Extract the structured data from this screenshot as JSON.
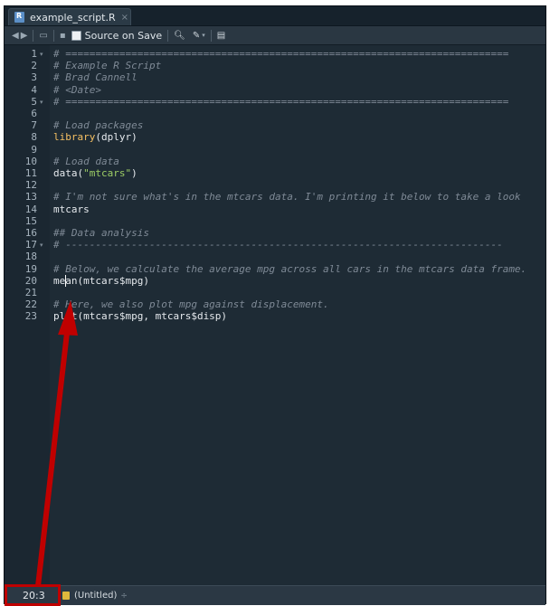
{
  "tab": {
    "label": "example_script.R",
    "close": "×"
  },
  "toolbar": {
    "source_on_save": "Source on Save"
  },
  "editor": {
    "lines": [
      {
        "n": "1",
        "fold": true,
        "segs": [
          {
            "t": "# ==========================================================================",
            "c": "cm"
          }
        ]
      },
      {
        "n": "2",
        "segs": [
          {
            "t": "# Example R Script",
            "c": "cm"
          }
        ]
      },
      {
        "n": "3",
        "segs": [
          {
            "t": "# Brad Cannell",
            "c": "cm"
          }
        ]
      },
      {
        "n": "4",
        "segs": [
          {
            "t": "# <Date>",
            "c": "cm"
          }
        ]
      },
      {
        "n": "5",
        "fold": true,
        "segs": [
          {
            "t": "# ==========================================================================",
            "c": "cm"
          }
        ]
      },
      {
        "n": "6",
        "segs": []
      },
      {
        "n": "7",
        "segs": [
          {
            "t": "# Load packages",
            "c": "cm"
          }
        ]
      },
      {
        "n": "8",
        "segs": [
          {
            "t": "library",
            "c": "fn"
          },
          {
            "t": "(dplyr)",
            "c": ""
          }
        ]
      },
      {
        "n": "9",
        "segs": []
      },
      {
        "n": "10",
        "segs": [
          {
            "t": "# Load data",
            "c": "cm"
          }
        ]
      },
      {
        "n": "11",
        "segs": [
          {
            "t": "data(",
            "c": ""
          },
          {
            "t": "\"mtcars\"",
            "c": "str"
          },
          {
            "t": ")",
            "c": ""
          }
        ]
      },
      {
        "n": "12",
        "segs": []
      },
      {
        "n": "13",
        "segs": [
          {
            "t": "# I'm not sure what's in the mtcars data. I'm printing it below to take a look",
            "c": "cm"
          }
        ]
      },
      {
        "n": "14",
        "segs": [
          {
            "t": "mtcars",
            "c": ""
          }
        ]
      },
      {
        "n": "15",
        "segs": []
      },
      {
        "n": "16",
        "segs": [
          {
            "t": "## Data analysis",
            "c": "cm"
          }
        ]
      },
      {
        "n": "17",
        "fold": true,
        "segs": [
          {
            "t": "# -------------------------------------------------------------------------",
            "c": "cm"
          }
        ]
      },
      {
        "n": "18",
        "segs": []
      },
      {
        "n": "19",
        "segs": [
          {
            "t": "# Below, we calculate the average mpg across all cars in the mtcars data frame.",
            "c": "cm"
          }
        ]
      },
      {
        "n": "20",
        "segs": [
          {
            "t": "mean(mtcars$mpg)",
            "c": ""
          }
        ]
      },
      {
        "n": "21",
        "segs": []
      },
      {
        "n": "22",
        "segs": [
          {
            "t": "# Here, we also plot mpg against displacement.",
            "c": "cm"
          }
        ]
      },
      {
        "n": "23",
        "segs": [
          {
            "t": "plot(mtcars$mpg, mtcars$disp)",
            "c": ""
          }
        ]
      }
    ]
  },
  "status": {
    "position": "20:3",
    "context": "(Untitled)",
    "context_chevron": "÷"
  },
  "colors": {
    "annotation": "#c00000",
    "background": "#1e2b35"
  }
}
